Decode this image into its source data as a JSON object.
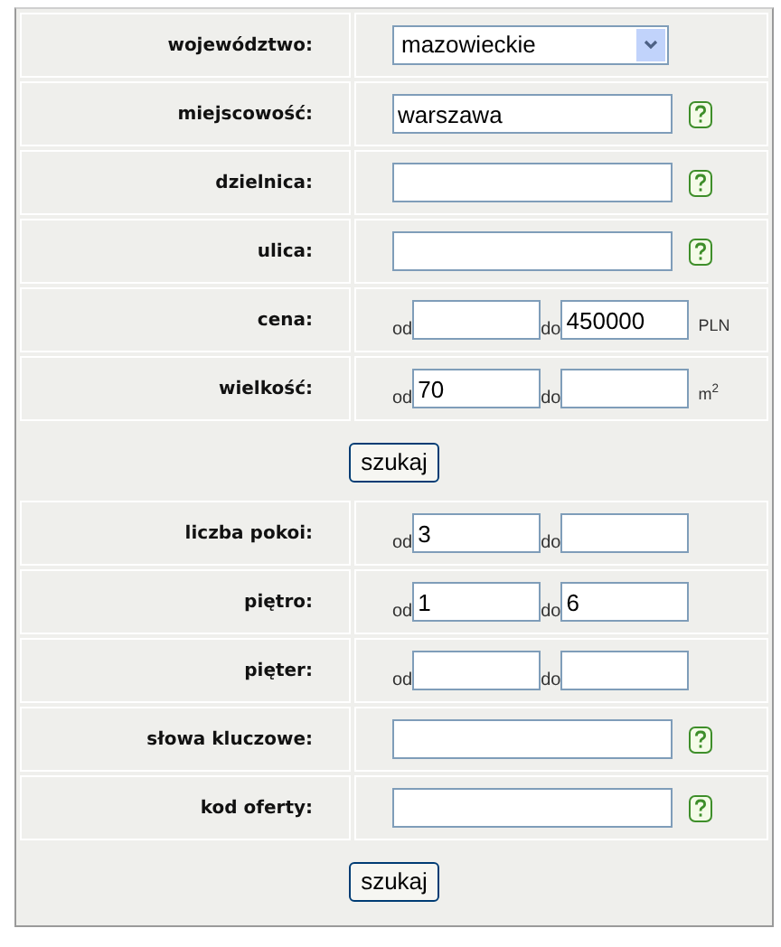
{
  "sections": [
    {
      "kind": "row",
      "label": "województwo:",
      "field": {
        "kind": "select",
        "value": "mazowieckie"
      }
    },
    {
      "kind": "row",
      "label": "miejscowość:",
      "field": {
        "kind": "text",
        "value": "warszawa",
        "help": true
      }
    },
    {
      "kind": "row",
      "label": "dzielnica:",
      "field": {
        "kind": "text",
        "help": true
      }
    },
    {
      "kind": "row",
      "label": "ulica:",
      "field": {
        "kind": "text",
        "help": true
      }
    },
    {
      "kind": "row",
      "label": "cena:",
      "field": {
        "kind": "range",
        "from_label": "od",
        "to_label": "do",
        "to": "450000",
        "unit": "PLN"
      }
    },
    {
      "kind": "row",
      "label": "wielkość:",
      "field": {
        "kind": "range",
        "from_label": "od",
        "from": "70",
        "to_label": "do",
        "unit": "m$^{2}$"
      }
    },
    {
      "kind": "button",
      "label": "szukaj"
    },
    {
      "kind": "row",
      "label": "liczba pokoi:",
      "field": {
        "kind": "range",
        "from_label": "od",
        "from": "3",
        "to_label": "do"
      }
    },
    {
      "kind": "row",
      "label": "piętro:",
      "field": {
        "kind": "range",
        "from_label": "od",
        "from": "1",
        "to_label": "do",
        "to": "6"
      }
    },
    {
      "kind": "row",
      "label": "pięter:",
      "field": {
        "kind": "range",
        "from_label": "od",
        "to_label": "do"
      }
    },
    {
      "kind": "row",
      "label": "słowa kluczowe:",
      "field": {
        "kind": "text",
        "help": true
      }
    },
    {
      "kind": "row",
      "label": "kod oferty:",
      "field": {
        "kind": "text",
        "help": true
      }
    },
    {
      "kind": "button",
      "label": "szukaj"
    }
  ]
}
